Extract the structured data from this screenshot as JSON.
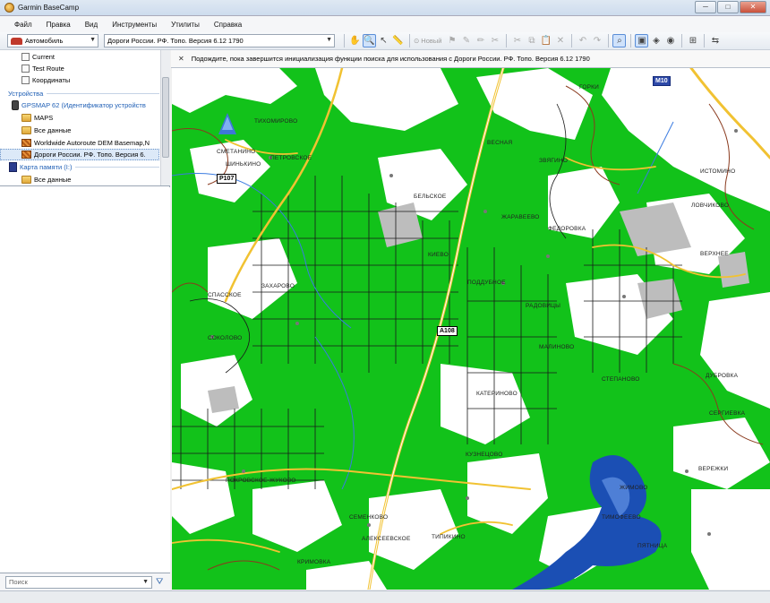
{
  "window": {
    "title": "Garmin BaseCamp",
    "min_glyph": "─",
    "max_glyph": "□",
    "close_glyph": "✕"
  },
  "menu": [
    "Файл",
    "Правка",
    "Вид",
    "Инструменты",
    "Утилиты",
    "Справка"
  ],
  "toolbar": {
    "profile": "Автомобиль",
    "map_product": "Дороги России. РФ. Топо. Версия 6.12 1790",
    "new_label": "Новый",
    "dropdown_glyph": "▼"
  },
  "tree": {
    "items": [
      {
        "label": "Current"
      },
      {
        "label": "Test Route"
      },
      {
        "label": "Координаты"
      }
    ],
    "devices_header": "Устройства",
    "device": "GPSMAP 62  (Идентификатор устройств",
    "device_children": [
      "MAPS",
      "Все данные",
      "Worldwide Autoroute DEM Basemap,N",
      "Дороги России. РФ. Топо. Версия 6."
    ],
    "card": "Карта памяти (I:)",
    "card_children": [
      "Все данные"
    ]
  },
  "search": {
    "placeholder": "Поиск"
  },
  "notice": {
    "close_glyph": "✕",
    "text": "Подождите, пока завершится инициализация функции поиска для использования с Дороги России. РФ. Топо. Версия 6.12 1790"
  },
  "map": {
    "routes": [
      "M10",
      "P107",
      "A108"
    ],
    "places": [
      "ТИХОМИРОВО",
      "СМЕТАНИНО",
      "ПЕТРОВСКОЕ",
      "ШИНЬКИНО",
      "ВЕСНАЯ",
      "ЖАРАВЕЕВО",
      "ПОДДУБНОЕ",
      "СОКОЛОВО",
      "СПАССКОЕ",
      "ЗАХАРОВО",
      "АЛЕКСЕЕВСКОЕ",
      "КУЗНЕЦОВО",
      "ПОКРОВСКОЕ-ЖУКОВО",
      "СЕМЕНКОВО",
      "ТИПИКИНО",
      "КРИМОВКА",
      "ТИМОФЕЕВО",
      "ГОРКИ",
      "ВЕРЕЖКИ",
      "ЖИМОВО",
      "РАДОВИЦЫ",
      "СЕРГИЕВКА",
      "МАЛИНОВО",
      "СТЕПАНОВО",
      "КАТЕРИНОВО",
      "КИЕВО",
      "ПЯТНИЦА",
      "ИСТОМИНО",
      "ЗВЯГИНО",
      "ФЕДОРОВКА",
      "ЛОВЧИКОВО",
      "БЕЛЬСКОЕ",
      "ВЕРХНЕЕ",
      "ДУБРОВКА"
    ]
  }
}
